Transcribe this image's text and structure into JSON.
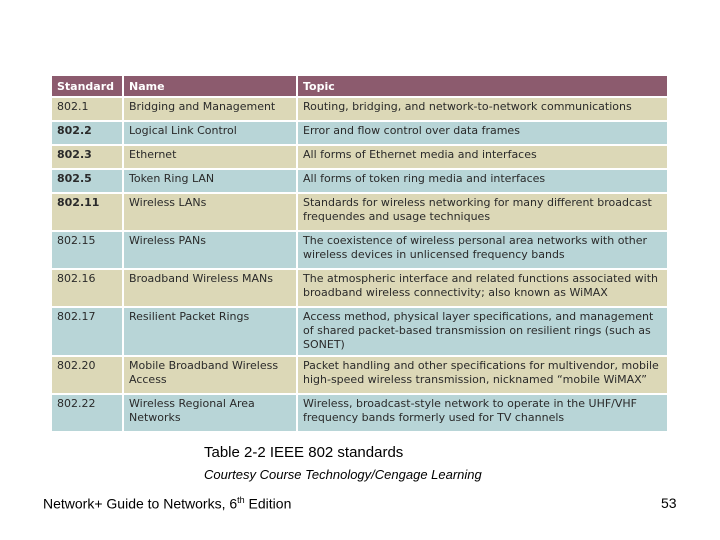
{
  "table": {
    "headers": [
      "Standard",
      "Name",
      "Topic"
    ],
    "colors": {
      "header": "#8c5b6e",
      "row_tan": "#dcd8b7",
      "row_blue": "#b8d5d7"
    },
    "rows": [
      {
        "standard": "802.1",
        "name": "Bridging and Management",
        "topic": "Routing, bridging, and network-to-network communications",
        "style": "tan"
      },
      {
        "standard": "802.2",
        "name": "Logical Link Control",
        "topic": "Error and flow control over data frames",
        "style": "blue"
      },
      {
        "standard": "802.3",
        "name": "Ethernet",
        "topic": "All forms of Ethernet media and interfaces",
        "style": "tan"
      },
      {
        "standard": "802.5",
        "name": "Token Ring LAN",
        "topic": "All forms of token ring media and interfaces",
        "style": "blue"
      },
      {
        "standard": "802.11",
        "name": "Wireless LANs",
        "topic": "Standards for wireless networking for many different broadcast frequendes and usage techniques",
        "style": "tan"
      },
      {
        "standard": "802.15",
        "name": "Wireless PANs",
        "topic": "The coexistence of wireless personal area networks with other wireless devices in unlicensed frequency bands",
        "style": "blue"
      },
      {
        "standard": "802.16",
        "name": "Broadband Wireless MANs",
        "topic": "The atmospheric interface and related functions associated with broadband wireless connectivity; also known as WiMAX",
        "style": "tan"
      },
      {
        "standard": "802.17",
        "name": "Resilient Packet Rings",
        "topic": "Access method, physical layer specifications, and management of shared packet-based transmission on resilient rings (such as SONET)",
        "style": "blue"
      },
      {
        "standard": "802.20",
        "name": "Mobile Broadband Wireless Access",
        "topic": "Packet handling and other specifications for multivendor, mobile high-speed wireless transmission, nicknamed “mobile WiMAX”",
        "style": "tan"
      },
      {
        "standard": "802.22",
        "name": "Wireless Regional Area Networks",
        "topic": "Wireless, broadcast-style network to operate in the UHF/VHF frequency bands formerly used for TV channels",
        "style": "blue"
      }
    ]
  },
  "caption": "Table 2-2 IEEE 802 standards",
  "credit": "Courtesy Course Technology/Cengage Learning",
  "footer": {
    "title_main": "Network+ Guide to Networks, 6",
    "title_sup": "th",
    "title_end": " Edition",
    "page_number": "53"
  }
}
